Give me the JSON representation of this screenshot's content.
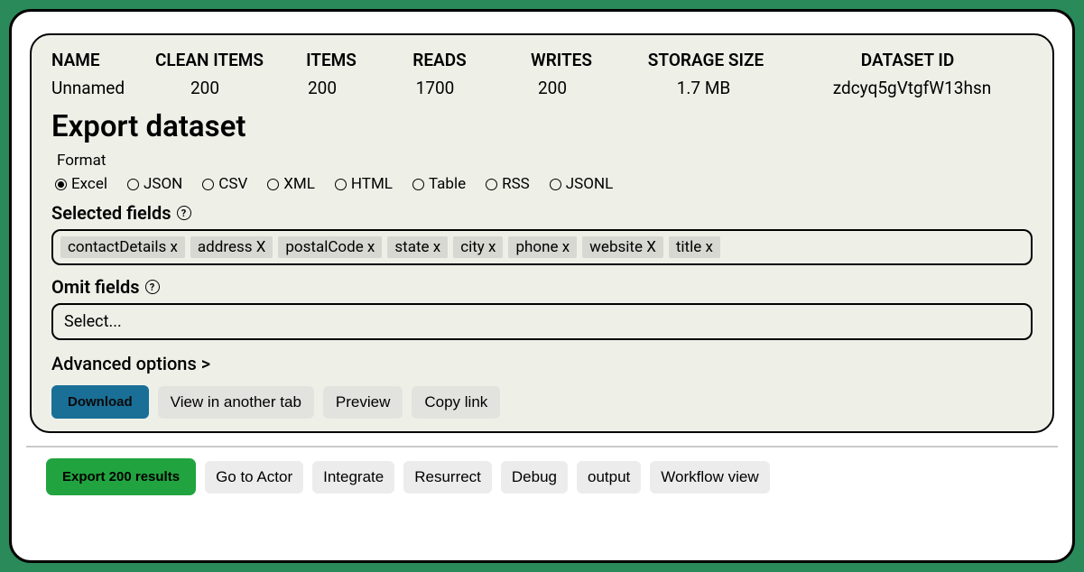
{
  "stats": {
    "headers": {
      "name": "NAME",
      "clean": "CLEAN ITEMS",
      "items": "ITEMS",
      "reads": "READS",
      "writes": "WRITES",
      "storage": "STORAGE SIZE",
      "dsid": "DATASET ID"
    },
    "values": {
      "name": "Unnamed",
      "clean": "200",
      "items": "200",
      "reads": "1700",
      "writes": "200",
      "storage": "1.7 MB",
      "dsid": "zdcyq5gVtgfW13hsn"
    }
  },
  "export": {
    "title": "Export dataset",
    "format_label": "Format",
    "formats": [
      "Excel",
      "JSON",
      "CSV",
      "XML",
      "HTML",
      "Table",
      "RSS",
      "JSONL"
    ],
    "selected_format": "Excel",
    "selected_fields_label": "Selected fields",
    "selected_chips": [
      "contactDetails x",
      "address X",
      "postalCode x",
      "state x",
      "city x",
      "phone x",
      "website X",
      "title x"
    ],
    "omit_fields_label": "Omit fields",
    "omit_placeholder": "Select...",
    "advanced_label": "Advanced options >",
    "buttons": {
      "download": "Download",
      "view_tab": "View in another tab",
      "preview": "Preview",
      "copy_link": "Copy link"
    }
  },
  "footer": {
    "export_results": "Export 200 results",
    "go_actor": "Go to Actor",
    "integrate": "Integrate",
    "resurrect": "Resurrect",
    "debug": "Debug",
    "output": "output",
    "workflow": "Workflow view"
  },
  "help_glyph": "?"
}
